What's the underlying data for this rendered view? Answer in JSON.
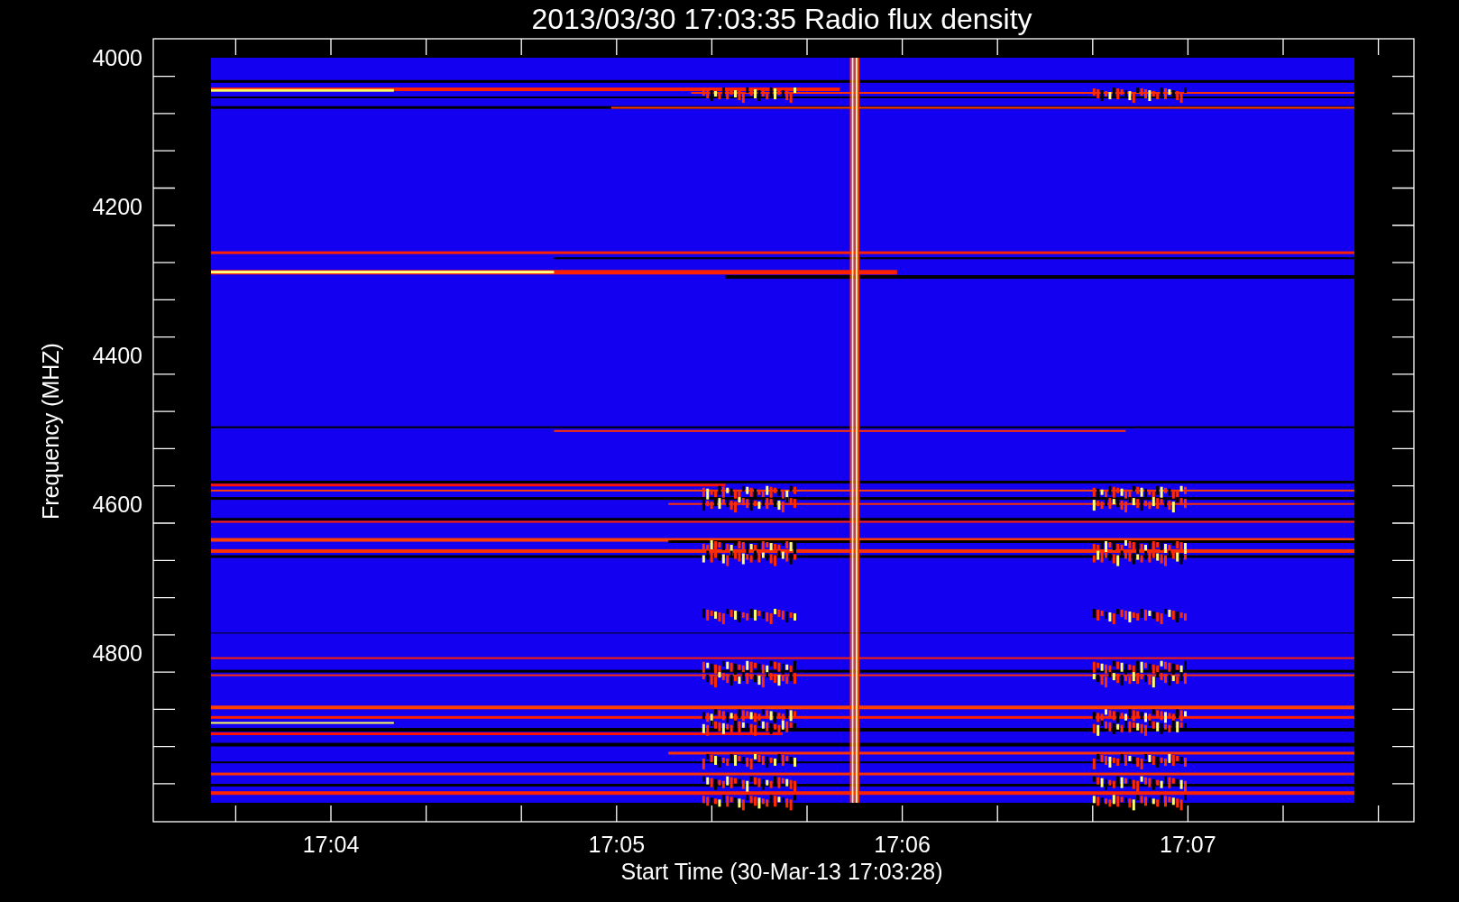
{
  "title": "2013/03/30 17:03:35 Radio flux density",
  "plot": {
    "ylabel": "Frequency (MHZ)",
    "xlabel": "Start Time (30-Mar-13 17:03:28)",
    "yticks": [
      "4000",
      "4200",
      "4400",
      "4600",
      "4800"
    ],
    "xticks": [
      "17:04",
      "17:05",
      "17:06",
      "17:07"
    ]
  }
}
